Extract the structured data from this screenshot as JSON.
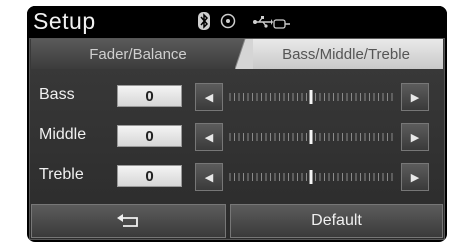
{
  "header": {
    "title": "Setup",
    "status_icons": [
      "bluetooth-icon",
      "disc-icon",
      "usb-icon",
      "aux-plug-icon"
    ]
  },
  "tabs": [
    {
      "label": "Fader/Balance",
      "selected": false
    },
    {
      "label": "Bass/Middle/Treble",
      "selected": true
    }
  ],
  "rows": [
    {
      "label": "Bass",
      "value": "0",
      "level": 0.5
    },
    {
      "label": "Middle",
      "value": "0",
      "level": 0.5
    },
    {
      "label": "Treble",
      "value": "0",
      "level": 0.5
    }
  ],
  "footer": {
    "back_icon": "back-arrow-icon",
    "default_label": "Default"
  },
  "colors": {
    "background": "#000000",
    "panel": "#333333",
    "active_tab": "#d9d9d9",
    "text": "#f0f0f0"
  }
}
